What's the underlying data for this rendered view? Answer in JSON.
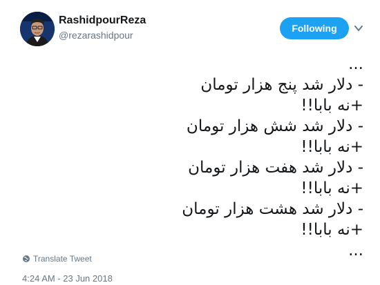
{
  "header": {
    "display_name": "RashidpourReza",
    "handle": "@rezarashidpour",
    "follow_label": "Following",
    "caret_icon": "chevron-down-icon",
    "avatar_icon": "profile-photo"
  },
  "tweet": {
    "lines": [
      "...",
      "- دلار شد پنج هزار تومان",
      "+نه بابا!!",
      "- دلار شد شش هزار تومان",
      "+نه بابا!!",
      "- دلار شد هفت هزار تومان",
      "+نه بابا!!",
      "- دلار شد هشت هزار تومان",
      "+نه بابا!!",
      "..."
    ]
  },
  "footer": {
    "translate_label": "Translate Tweet",
    "timestamp": "4:24 AM - 23 Jun 2018"
  },
  "colors": {
    "accent": "#1da1f2",
    "secondary_text": "#657786",
    "primary_text": "#14171a"
  }
}
